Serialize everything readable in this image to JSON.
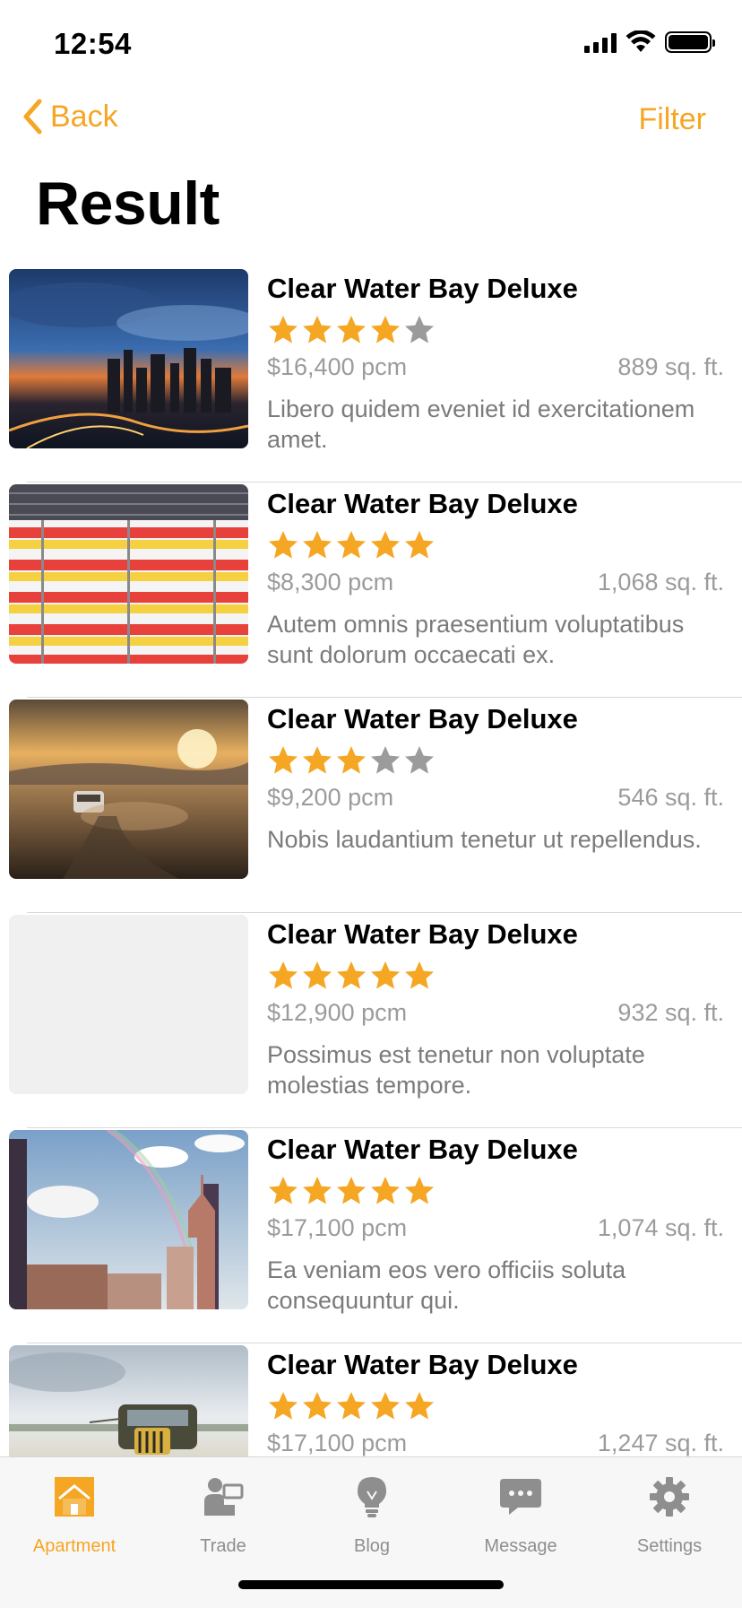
{
  "status": {
    "time": "12:54"
  },
  "nav": {
    "back_label": "Back",
    "filter_label": "Filter",
    "title": "Result"
  },
  "colors": {
    "accent": "#f5a623",
    "star_off": "#9b9b9b"
  },
  "listings": [
    {
      "name": "Clear Water Bay Deluxe",
      "rating": 4,
      "price": "$16,400 pcm",
      "area": "889 sq. ft.",
      "desc": "Libero quidem eveniet id exercitationem amet.",
      "image": "city-night"
    },
    {
      "name": "Clear Water Bay Deluxe",
      "rating": 5,
      "price": "$8,300 pcm",
      "area": "1,068 sq. ft.",
      "desc": "Autem omnis praesentium voluptatibus sunt dolorum occaecati ex.",
      "image": "striped-wall"
    },
    {
      "name": "Clear Water Bay Deluxe",
      "rating": 3,
      "price": "$9,200 pcm",
      "area": "546 sq. ft.",
      "desc": "Nobis laudantium tenetur ut repellendus.",
      "image": "desert-sunset"
    },
    {
      "name": "Clear Water Bay Deluxe",
      "rating": 5,
      "price": "$12,900 pcm",
      "area": "932 sq. ft.",
      "desc": "Possimus est tenetur non voluptate molestias tempore.",
      "image": "placeholder"
    },
    {
      "name": "Clear Water Bay Deluxe",
      "rating": 5,
      "price": "$17,100 pcm",
      "area": "1,074 sq. ft.",
      "desc": "Ea veniam eos vero officiis soluta consequuntur qui.",
      "image": "city-rainbow"
    },
    {
      "name": "Clear Water Bay Deluxe",
      "rating": 5,
      "price": "$17,100 pcm",
      "area": "1,247 sq. ft.",
      "desc": "",
      "image": "old-truck"
    }
  ],
  "tabs": [
    {
      "label": "Apartment",
      "icon": "house-icon",
      "active": true
    },
    {
      "label": "Trade",
      "icon": "trade-icon",
      "active": false
    },
    {
      "label": "Blog",
      "icon": "lightbulb-icon",
      "active": false
    },
    {
      "label": "Message",
      "icon": "message-icon",
      "active": false
    },
    {
      "label": "Settings",
      "icon": "gear-icon",
      "active": false
    }
  ]
}
